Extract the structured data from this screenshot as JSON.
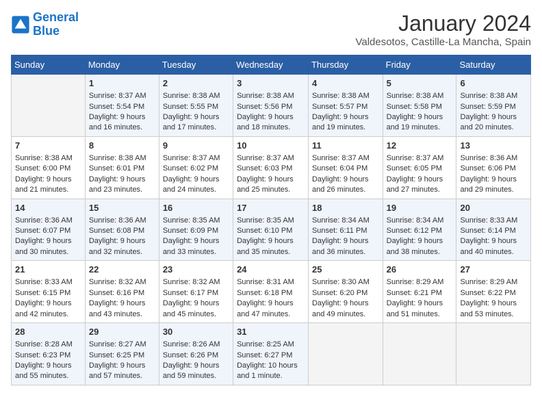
{
  "header": {
    "logo_line1": "General",
    "logo_line2": "Blue",
    "title": "January 2024",
    "subtitle": "Valdesotos, Castille-La Mancha, Spain"
  },
  "days_of_week": [
    "Sunday",
    "Monday",
    "Tuesday",
    "Wednesday",
    "Thursday",
    "Friday",
    "Saturday"
  ],
  "weeks": [
    [
      {
        "day": "",
        "content": ""
      },
      {
        "day": "1",
        "content": "Sunrise: 8:37 AM\nSunset: 5:54 PM\nDaylight: 9 hours\nand 16 minutes."
      },
      {
        "day": "2",
        "content": "Sunrise: 8:38 AM\nSunset: 5:55 PM\nDaylight: 9 hours\nand 17 minutes."
      },
      {
        "day": "3",
        "content": "Sunrise: 8:38 AM\nSunset: 5:56 PM\nDaylight: 9 hours\nand 18 minutes."
      },
      {
        "day": "4",
        "content": "Sunrise: 8:38 AM\nSunset: 5:57 PM\nDaylight: 9 hours\nand 19 minutes."
      },
      {
        "day": "5",
        "content": "Sunrise: 8:38 AM\nSunset: 5:58 PM\nDaylight: 9 hours\nand 19 minutes."
      },
      {
        "day": "6",
        "content": "Sunrise: 8:38 AM\nSunset: 5:59 PM\nDaylight: 9 hours\nand 20 minutes."
      }
    ],
    [
      {
        "day": "7",
        "content": "Sunrise: 8:38 AM\nSunset: 6:00 PM\nDaylight: 9 hours\nand 21 minutes."
      },
      {
        "day": "8",
        "content": "Sunrise: 8:38 AM\nSunset: 6:01 PM\nDaylight: 9 hours\nand 23 minutes."
      },
      {
        "day": "9",
        "content": "Sunrise: 8:37 AM\nSunset: 6:02 PM\nDaylight: 9 hours\nand 24 minutes."
      },
      {
        "day": "10",
        "content": "Sunrise: 8:37 AM\nSunset: 6:03 PM\nDaylight: 9 hours\nand 25 minutes."
      },
      {
        "day": "11",
        "content": "Sunrise: 8:37 AM\nSunset: 6:04 PM\nDaylight: 9 hours\nand 26 minutes."
      },
      {
        "day": "12",
        "content": "Sunrise: 8:37 AM\nSunset: 6:05 PM\nDaylight: 9 hours\nand 27 minutes."
      },
      {
        "day": "13",
        "content": "Sunrise: 8:36 AM\nSunset: 6:06 PM\nDaylight: 9 hours\nand 29 minutes."
      }
    ],
    [
      {
        "day": "14",
        "content": "Sunrise: 8:36 AM\nSunset: 6:07 PM\nDaylight: 9 hours\nand 30 minutes."
      },
      {
        "day": "15",
        "content": "Sunrise: 8:36 AM\nSunset: 6:08 PM\nDaylight: 9 hours\nand 32 minutes."
      },
      {
        "day": "16",
        "content": "Sunrise: 8:35 AM\nSunset: 6:09 PM\nDaylight: 9 hours\nand 33 minutes."
      },
      {
        "day": "17",
        "content": "Sunrise: 8:35 AM\nSunset: 6:10 PM\nDaylight: 9 hours\nand 35 minutes."
      },
      {
        "day": "18",
        "content": "Sunrise: 8:34 AM\nSunset: 6:11 PM\nDaylight: 9 hours\nand 36 minutes."
      },
      {
        "day": "19",
        "content": "Sunrise: 8:34 AM\nSunset: 6:12 PM\nDaylight: 9 hours\nand 38 minutes."
      },
      {
        "day": "20",
        "content": "Sunrise: 8:33 AM\nSunset: 6:14 PM\nDaylight: 9 hours\nand 40 minutes."
      }
    ],
    [
      {
        "day": "21",
        "content": "Sunrise: 8:33 AM\nSunset: 6:15 PM\nDaylight: 9 hours\nand 42 minutes."
      },
      {
        "day": "22",
        "content": "Sunrise: 8:32 AM\nSunset: 6:16 PM\nDaylight: 9 hours\nand 43 minutes."
      },
      {
        "day": "23",
        "content": "Sunrise: 8:32 AM\nSunset: 6:17 PM\nDaylight: 9 hours\nand 45 minutes."
      },
      {
        "day": "24",
        "content": "Sunrise: 8:31 AM\nSunset: 6:18 PM\nDaylight: 9 hours\nand 47 minutes."
      },
      {
        "day": "25",
        "content": "Sunrise: 8:30 AM\nSunset: 6:20 PM\nDaylight: 9 hours\nand 49 minutes."
      },
      {
        "day": "26",
        "content": "Sunrise: 8:29 AM\nSunset: 6:21 PM\nDaylight: 9 hours\nand 51 minutes."
      },
      {
        "day": "27",
        "content": "Sunrise: 8:29 AM\nSunset: 6:22 PM\nDaylight: 9 hours\nand 53 minutes."
      }
    ],
    [
      {
        "day": "28",
        "content": "Sunrise: 8:28 AM\nSunset: 6:23 PM\nDaylight: 9 hours\nand 55 minutes."
      },
      {
        "day": "29",
        "content": "Sunrise: 8:27 AM\nSunset: 6:25 PM\nDaylight: 9 hours\nand 57 minutes."
      },
      {
        "day": "30",
        "content": "Sunrise: 8:26 AM\nSunset: 6:26 PM\nDaylight: 9 hours\nand 59 minutes."
      },
      {
        "day": "31",
        "content": "Sunrise: 8:25 AM\nSunset: 6:27 PM\nDaylight: 10 hours\nand 1 minute."
      },
      {
        "day": "",
        "content": ""
      },
      {
        "day": "",
        "content": ""
      },
      {
        "day": "",
        "content": ""
      }
    ]
  ]
}
